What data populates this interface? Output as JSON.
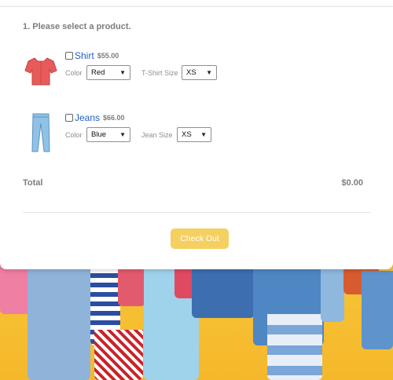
{
  "form": {
    "heading": "1. Please select a product.",
    "total_label": "Total",
    "total_value": "$0.00",
    "checkout_label": "Check Out"
  },
  "products": [
    {
      "name": "Shirt",
      "price": "$55.00",
      "checked": false,
      "color_label": "Color",
      "color_value": "Red",
      "size_label": "T-Shirt Size",
      "size_value": "XS",
      "thumb_color": "#e95b5b"
    },
    {
      "name": "Jeans",
      "price": "$66.00",
      "checked": false,
      "color_label": "Color",
      "color_value": "Blue",
      "size_label": "Jean Size",
      "size_value": "XS",
      "thumb_color": "#8fc2e6"
    }
  ],
  "colors": {
    "accent_button": "#f5d061",
    "link": "#1f5fc4",
    "background_photo": "#f7c43a"
  }
}
